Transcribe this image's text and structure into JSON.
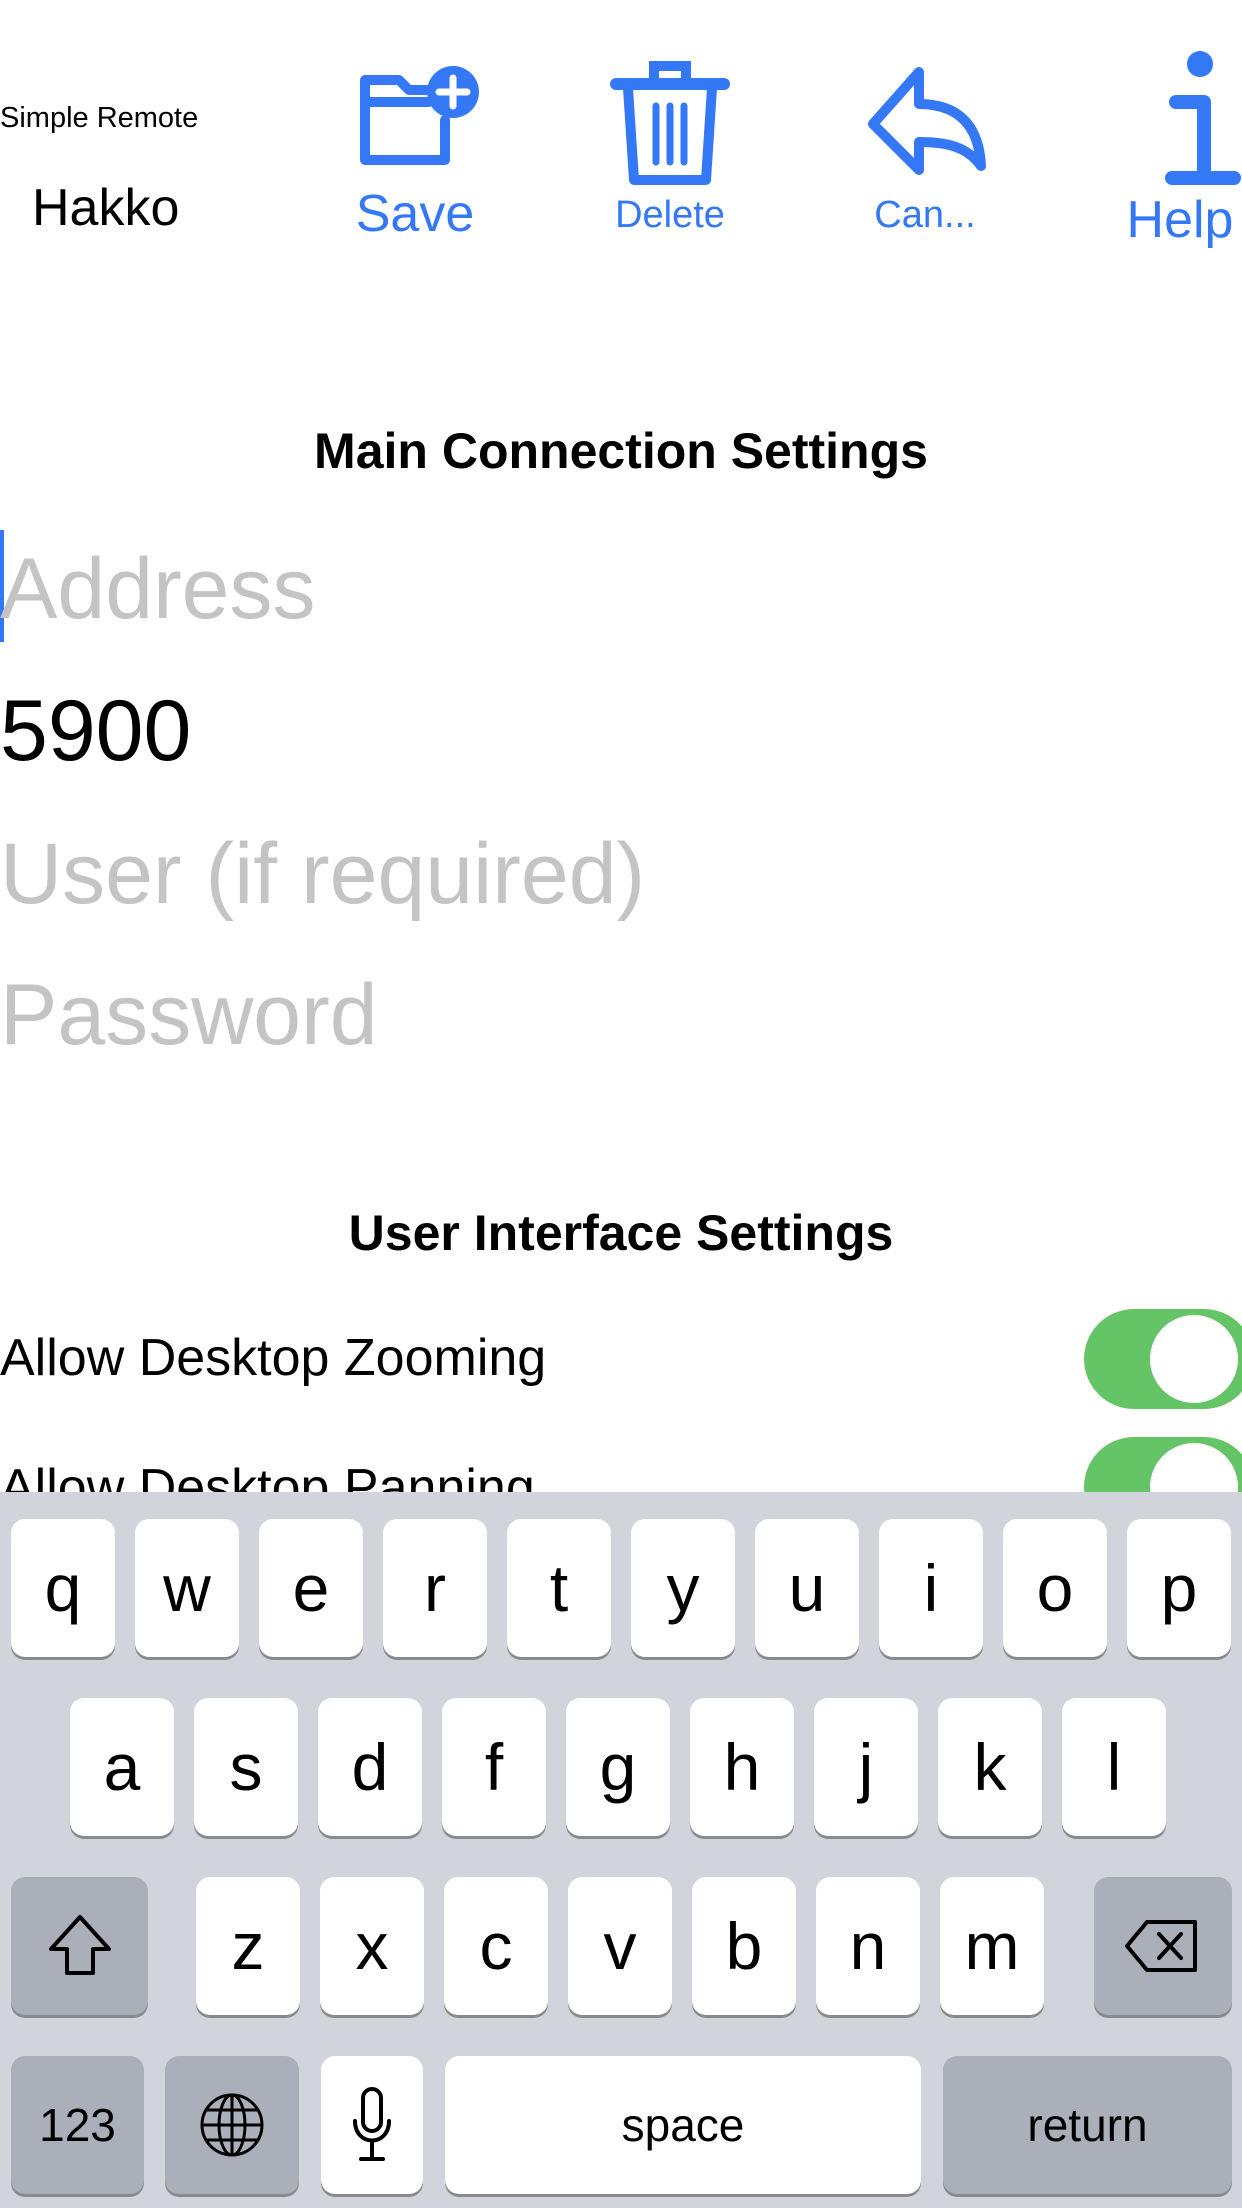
{
  "header": {
    "app_name": "Simple Remote",
    "connection_name": "Hakko"
  },
  "toolbar": [
    {
      "label": "Save",
      "icon": "folder-plus-icon"
    },
    {
      "label": "Delete",
      "icon": "trash-icon"
    },
    {
      "label": "Can...",
      "icon": "reply-arrow-icon"
    },
    {
      "label": "Help",
      "icon": "info-icon"
    }
  ],
  "accent_color": "#3478f6",
  "main_section": {
    "title": "Main Connection Settings",
    "address": {
      "value": "",
      "placeholder": "Address"
    },
    "port": {
      "value": "5900"
    },
    "user": {
      "value": "",
      "placeholder": "User (if required)"
    },
    "password": {
      "value": "",
      "placeholder": "Password"
    }
  },
  "ui_section": {
    "title": "User Interface Settings",
    "toggles": [
      {
        "label": "Allow Desktop Zooming",
        "on": true
      },
      {
        "label": "Allow Desktop Panning",
        "on": true
      }
    ],
    "toggle_color": "#65c466"
  },
  "keyboard": {
    "row1": [
      "q",
      "w",
      "e",
      "r",
      "t",
      "y",
      "u",
      "i",
      "o",
      "p"
    ],
    "row2": [
      "a",
      "s",
      "d",
      "f",
      "g",
      "h",
      "j",
      "k",
      "l"
    ],
    "row3": [
      "z",
      "x",
      "c",
      "v",
      "b",
      "n",
      "m"
    ],
    "numbers_label": "123",
    "space_label": "space",
    "return_label": "return"
  }
}
